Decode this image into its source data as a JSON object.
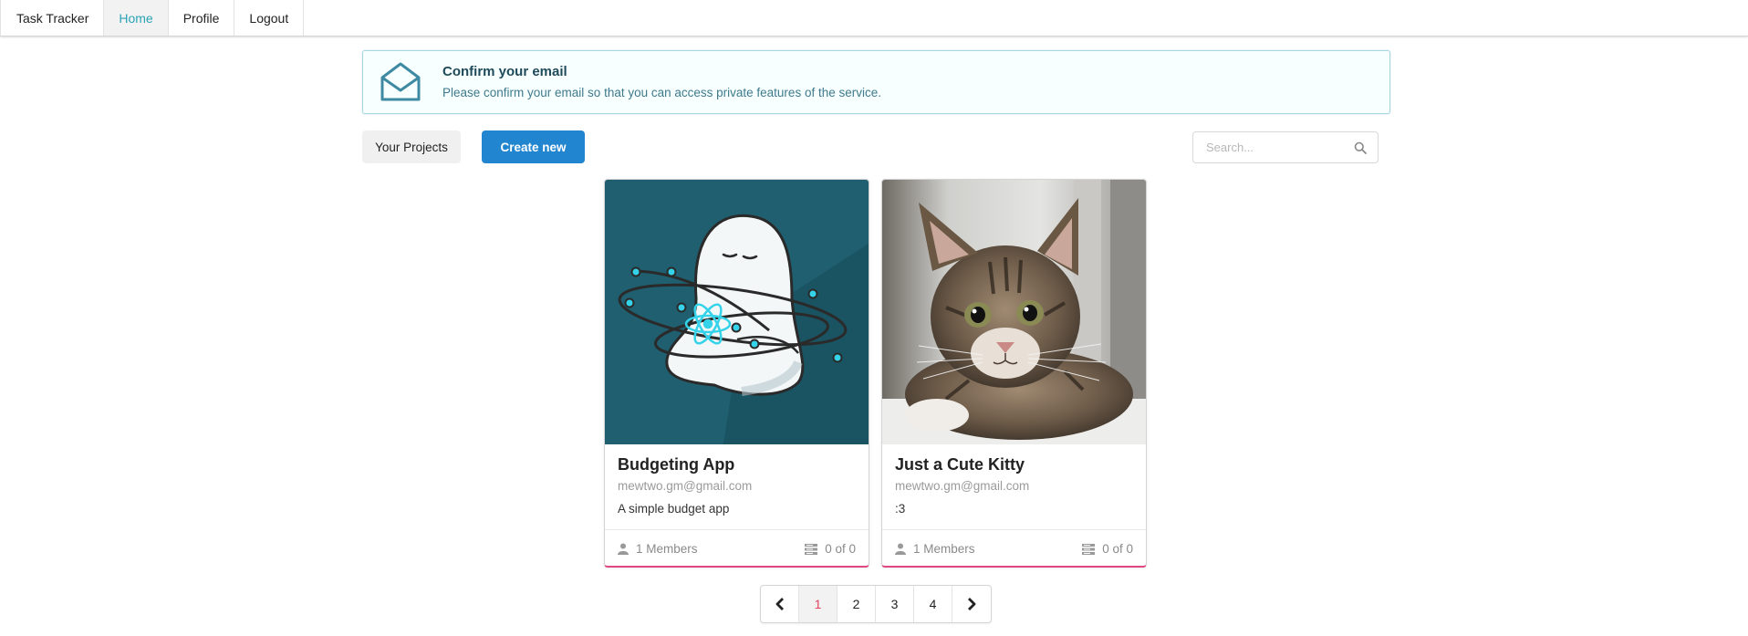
{
  "nav": {
    "brand": "Task Tracker",
    "items": [
      {
        "label": "Home",
        "active": true
      },
      {
        "label": "Profile",
        "active": false
      },
      {
        "label": "Logout",
        "active": false
      }
    ]
  },
  "banner": {
    "title": "Confirm your email",
    "text": "Please confirm your email so that you can access private features of the service.",
    "icon": "envelope-open-icon"
  },
  "toolbar": {
    "projects_label": "Your Projects",
    "create_label": "Create new",
    "search_placeholder": "Search..."
  },
  "projects": [
    {
      "title": "Budgeting App",
      "owner": "mewtwo.gm@gmail.com",
      "description": "A simple budget app",
      "members": "1 Members",
      "tasks": "0 of 0",
      "image": "react-ghost-illustration"
    },
    {
      "title": "Just a Cute Kitty",
      "owner": "mewtwo.gm@gmail.com",
      "description": ":3",
      "members": "1 Members",
      "tasks": "0 of 0",
      "image": "kitten-photo"
    }
  ],
  "pagination": {
    "prev_icon": "chevron-left-icon",
    "pages": [
      "1",
      "2",
      "3",
      "4"
    ],
    "active_page": "1",
    "next_icon": "chevron-right-icon"
  },
  "colors": {
    "accent": "#2aa3b7",
    "primary_button": "#2185d0",
    "card_border_bottom": "#e0467f",
    "active_page": "#e04660"
  }
}
